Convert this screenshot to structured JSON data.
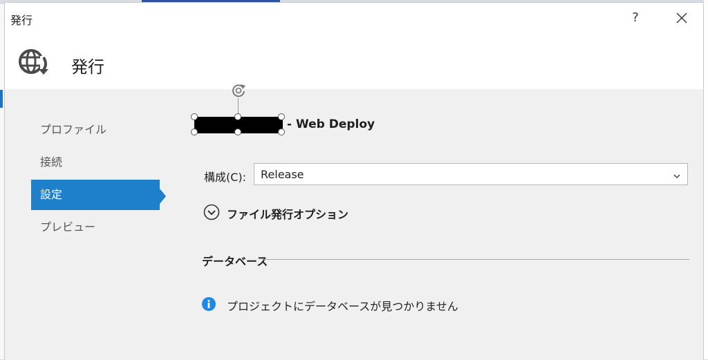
{
  "window": {
    "title": "発行",
    "help_label": "?"
  },
  "header": {
    "icon": "globe-publish-icon",
    "title": "発行"
  },
  "nav": {
    "items": [
      {
        "label": "プロファイル",
        "active": false
      },
      {
        "label": "接続",
        "active": false
      },
      {
        "label": "設定",
        "active": true
      },
      {
        "label": "プレビュー",
        "active": false
      }
    ]
  },
  "profile": {
    "name_suffix": "- Web Deploy"
  },
  "config": {
    "label": "構成(C):",
    "value": "Release"
  },
  "file_publish_options": {
    "label": "ファイル発行オプション"
  },
  "database": {
    "section_label": "データベース",
    "message": "プロジェクトにデータベースが見つかりません"
  },
  "colors": {
    "accent": "#1e7fcb",
    "info": "#1e88e5"
  }
}
